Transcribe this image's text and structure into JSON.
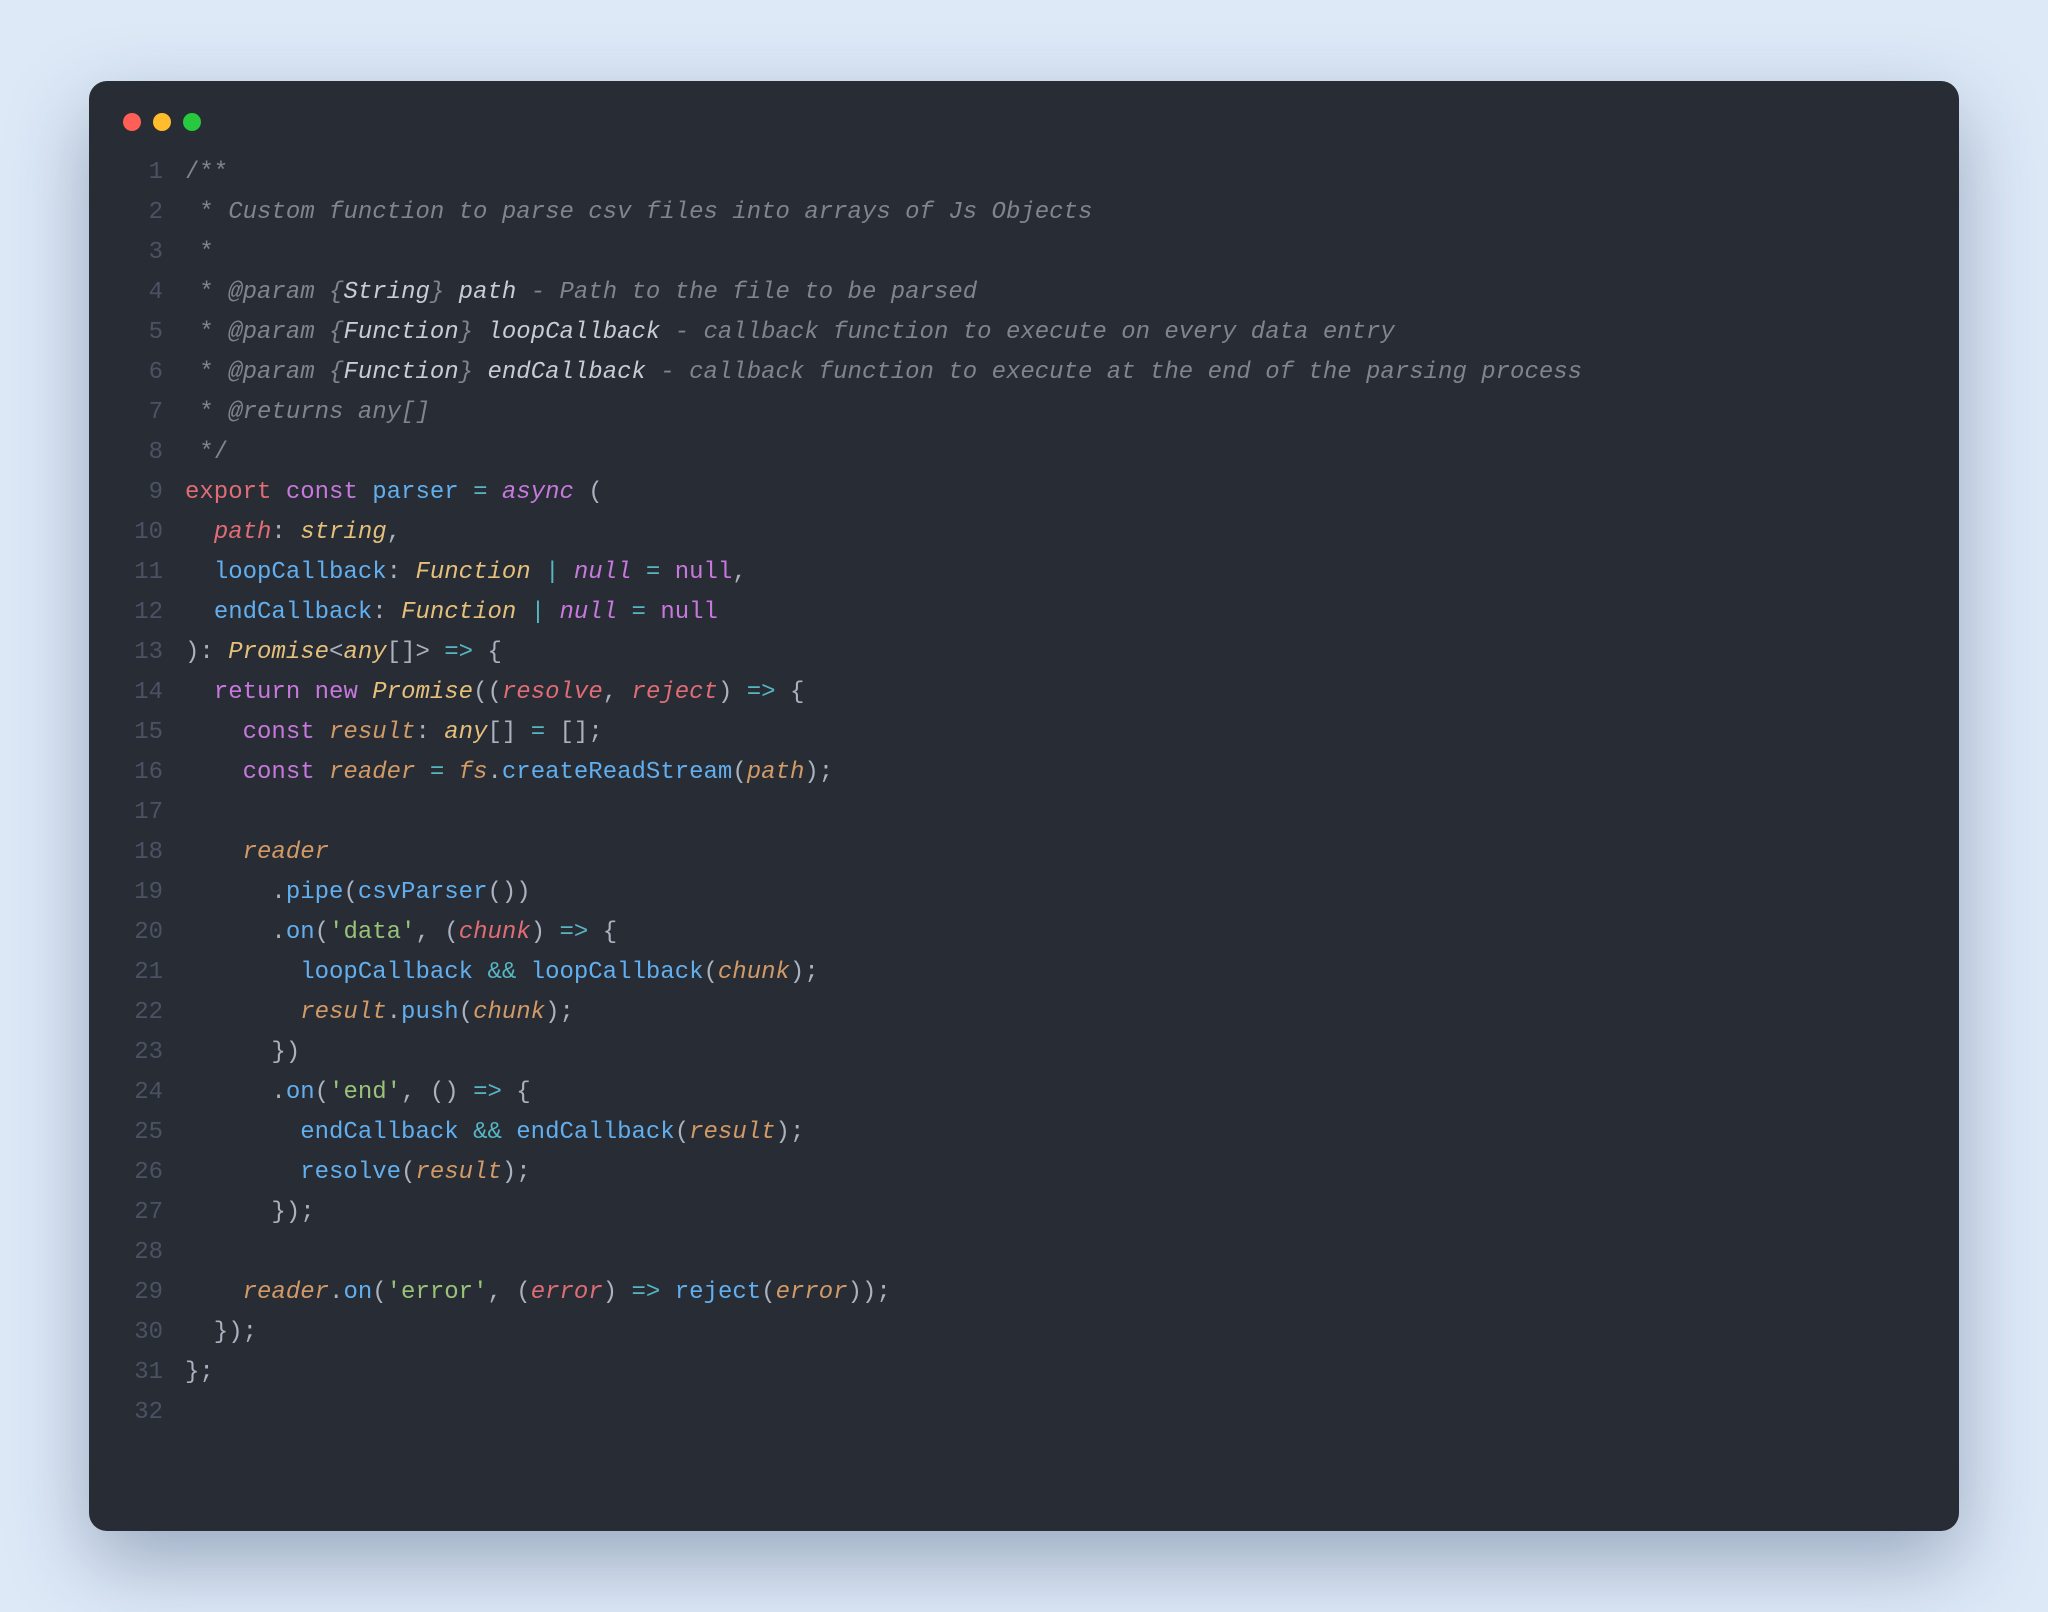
{
  "window": {
    "dots": [
      "red",
      "yellow",
      "green"
    ]
  },
  "gutter": {
    "lines": [
      "1",
      "2",
      "3",
      "4",
      "5",
      "6",
      "7",
      "8",
      "9",
      "10",
      "11",
      "12",
      "13",
      "14",
      "15",
      "16",
      "17",
      "18",
      "19",
      "20",
      "21",
      "22",
      "23",
      "24",
      "25",
      "26",
      "27",
      "28",
      "29",
      "30",
      "31",
      "32"
    ]
  },
  "code": {
    "lines": [
      [
        [
          "cm",
          "/**"
        ]
      ],
      [
        [
          "cm",
          " * "
        ],
        [
          "cmi",
          "Custom function to parse csv files into arrays of Js Objects"
        ]
      ],
      [
        [
          "cm",
          " *"
        ]
      ],
      [
        [
          "cm",
          " * "
        ],
        [
          "cmi",
          "@param "
        ],
        [
          "cmi",
          "{"
        ],
        [
          "cmw",
          "String"
        ],
        [
          "cmi",
          "}"
        ],
        [
          "cmw",
          " path"
        ],
        [
          "cmi",
          " - Path to the file to be parsed"
        ]
      ],
      [
        [
          "cm",
          " * "
        ],
        [
          "cmi",
          "@param "
        ],
        [
          "cmi",
          "{"
        ],
        [
          "cmw",
          "Function"
        ],
        [
          "cmi",
          "}"
        ],
        [
          "cmw",
          " loopCallback"
        ],
        [
          "cmi",
          " - callback function to execute on every data entry"
        ]
      ],
      [
        [
          "cm",
          " * "
        ],
        [
          "cmi",
          "@param "
        ],
        [
          "cmi",
          "{"
        ],
        [
          "cmw",
          "Function"
        ],
        [
          "cmi",
          "}"
        ],
        [
          "cmw",
          " endCallback"
        ],
        [
          "cmi",
          " - callback function to execute at the end of the parsing process"
        ]
      ],
      [
        [
          "cm",
          " * "
        ],
        [
          "cmi",
          "@returns "
        ],
        [
          "cmi",
          "any[]"
        ]
      ],
      [
        [
          "cm",
          " */"
        ]
      ],
      [
        [
          "kwr",
          "export"
        ],
        [
          "pn",
          " "
        ],
        [
          "kw",
          "const"
        ],
        [
          "pn",
          " "
        ],
        [
          "fn",
          "parser"
        ],
        [
          "pn",
          " "
        ],
        [
          "op",
          "="
        ],
        [
          "pn",
          " "
        ],
        [
          "kw ital",
          "async"
        ],
        [
          "pn",
          " ("
        ]
      ],
      [
        [
          "pn",
          "  "
        ],
        [
          "id",
          "path"
        ],
        [
          "pn",
          ": "
        ],
        [
          "ty",
          "string"
        ],
        [
          "pn",
          ","
        ]
      ],
      [
        [
          "pn",
          "  "
        ],
        [
          "fn",
          "loopCallback"
        ],
        [
          "pn",
          ": "
        ],
        [
          "ty",
          "Function"
        ],
        [
          "pn",
          " "
        ],
        [
          "op",
          "|"
        ],
        [
          "pn",
          " "
        ],
        [
          "kw ital",
          "null"
        ],
        [
          "pn",
          " "
        ],
        [
          "op",
          "="
        ],
        [
          "pn",
          " "
        ],
        [
          "kw",
          "null"
        ],
        [
          "pn",
          ","
        ]
      ],
      [
        [
          "pn",
          "  "
        ],
        [
          "fn",
          "endCallback"
        ],
        [
          "pn",
          ": "
        ],
        [
          "ty",
          "Function"
        ],
        [
          "pn",
          " "
        ],
        [
          "op",
          "|"
        ],
        [
          "pn",
          " "
        ],
        [
          "kw ital",
          "null"
        ],
        [
          "pn",
          " "
        ],
        [
          "op",
          "="
        ],
        [
          "pn",
          " "
        ],
        [
          "kw",
          "null"
        ]
      ],
      [
        [
          "pn",
          "): "
        ],
        [
          "ty",
          "Promise"
        ],
        [
          "pn",
          "<"
        ],
        [
          "ty",
          "any"
        ],
        [
          "pn",
          "[]> "
        ],
        [
          "op",
          "=>"
        ],
        [
          "pn",
          " {"
        ]
      ],
      [
        [
          "pn",
          "  "
        ],
        [
          "kw",
          "return"
        ],
        [
          "pn",
          " "
        ],
        [
          "kw",
          "new"
        ],
        [
          "pn",
          " "
        ],
        [
          "ty",
          "Promise"
        ],
        [
          "pn",
          "(("
        ],
        [
          "id",
          "resolve"
        ],
        [
          "pn",
          ", "
        ],
        [
          "id",
          "reject"
        ],
        [
          "pn",
          ") "
        ],
        [
          "op",
          "=>"
        ],
        [
          "pn",
          " {"
        ]
      ],
      [
        [
          "pn",
          "    "
        ],
        [
          "kw",
          "const"
        ],
        [
          "pn",
          " "
        ],
        [
          "idp",
          "result"
        ],
        [
          "pn",
          ": "
        ],
        [
          "ty",
          "any"
        ],
        [
          "pn",
          "[] "
        ],
        [
          "op",
          "="
        ],
        [
          "pn",
          " [];"
        ]
      ],
      [
        [
          "pn",
          "    "
        ],
        [
          "kw",
          "const"
        ],
        [
          "pn",
          " "
        ],
        [
          "idp",
          "reader"
        ],
        [
          "pn",
          " "
        ],
        [
          "op",
          "="
        ],
        [
          "pn",
          " "
        ],
        [
          "idp",
          "fs"
        ],
        [
          "pn",
          "."
        ],
        [
          "fn",
          "createReadStream"
        ],
        [
          "pn",
          "("
        ],
        [
          "idp",
          "path"
        ],
        [
          "pn",
          ");"
        ]
      ],
      [
        [
          "pn",
          ""
        ]
      ],
      [
        [
          "pn",
          "    "
        ],
        [
          "idp",
          "reader"
        ]
      ],
      [
        [
          "pn",
          "      ."
        ],
        [
          "fn",
          "pipe"
        ],
        [
          "pn",
          "("
        ],
        [
          "fn",
          "csvParser"
        ],
        [
          "pn",
          "())"
        ]
      ],
      [
        [
          "pn",
          "      ."
        ],
        [
          "fn",
          "on"
        ],
        [
          "pn",
          "("
        ],
        [
          "str",
          "'data'"
        ],
        [
          "pn",
          ", ("
        ],
        [
          "id",
          "chunk"
        ],
        [
          "pn",
          ") "
        ],
        [
          "op",
          "=>"
        ],
        [
          "pn",
          " {"
        ]
      ],
      [
        [
          "pn",
          "        "
        ],
        [
          "fn",
          "loopCallback"
        ],
        [
          "pn",
          " "
        ],
        [
          "op",
          "&&"
        ],
        [
          "pn",
          " "
        ],
        [
          "fn",
          "loopCallback"
        ],
        [
          "pn",
          "("
        ],
        [
          "idp",
          "chunk"
        ],
        [
          "pn",
          ");"
        ]
      ],
      [
        [
          "pn",
          "        "
        ],
        [
          "idp",
          "result"
        ],
        [
          "pn",
          "."
        ],
        [
          "fn",
          "push"
        ],
        [
          "pn",
          "("
        ],
        [
          "idp",
          "chunk"
        ],
        [
          "pn",
          ");"
        ]
      ],
      [
        [
          "pn",
          "      })"
        ]
      ],
      [
        [
          "pn",
          "      ."
        ],
        [
          "fn",
          "on"
        ],
        [
          "pn",
          "("
        ],
        [
          "str",
          "'end'"
        ],
        [
          "pn",
          ", () "
        ],
        [
          "op",
          "=>"
        ],
        [
          "pn",
          " {"
        ]
      ],
      [
        [
          "pn",
          "        "
        ],
        [
          "fn",
          "endCallback"
        ],
        [
          "pn",
          " "
        ],
        [
          "op",
          "&&"
        ],
        [
          "pn",
          " "
        ],
        [
          "fn",
          "endCallback"
        ],
        [
          "pn",
          "("
        ],
        [
          "idp",
          "result"
        ],
        [
          "pn",
          ");"
        ]
      ],
      [
        [
          "pn",
          "        "
        ],
        [
          "fn",
          "resolve"
        ],
        [
          "pn",
          "("
        ],
        [
          "idp",
          "result"
        ],
        [
          "pn",
          ");"
        ]
      ],
      [
        [
          "pn",
          "      });"
        ]
      ],
      [
        [
          "pn",
          ""
        ]
      ],
      [
        [
          "pn",
          "    "
        ],
        [
          "idp",
          "reader"
        ],
        [
          "pn",
          "."
        ],
        [
          "fn",
          "on"
        ],
        [
          "pn",
          "("
        ],
        [
          "str",
          "'error'"
        ],
        [
          "pn",
          ", ("
        ],
        [
          "id",
          "error"
        ],
        [
          "pn",
          ") "
        ],
        [
          "op",
          "=>"
        ],
        [
          "pn",
          " "
        ],
        [
          "fn",
          "reject"
        ],
        [
          "pn",
          "("
        ],
        [
          "idp",
          "error"
        ],
        [
          "pn",
          "));"
        ]
      ],
      [
        [
          "pn",
          "  });"
        ]
      ],
      [
        [
          "pn",
          "};"
        ]
      ],
      [
        [
          "pn",
          ""
        ]
      ]
    ]
  }
}
